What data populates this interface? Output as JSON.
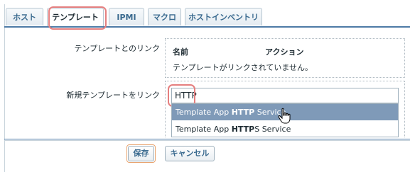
{
  "tabs": [
    {
      "label": "ホスト"
    },
    {
      "label": "テンプレート"
    },
    {
      "label": "IPMI"
    },
    {
      "label": "マクロ"
    },
    {
      "label": "ホストインベントリ"
    }
  ],
  "active_tab": "テンプレート",
  "linked": {
    "label": "テンプレートとのリンク",
    "col_name": "名前",
    "col_action": "アクション",
    "empty_message": "テンプレートがリンクされていません。"
  },
  "new_link": {
    "label": "新規テンプレートをリンク",
    "input_value": "HTTP",
    "suggestions": [
      {
        "prefix": "Template App ",
        "match": "HTTP",
        "suffix": " Service"
      },
      {
        "prefix": "Template App ",
        "match": "HTTP",
        "suffix": "S Service"
      }
    ]
  },
  "buttons": {
    "save": "保存",
    "cancel": "キャンセル"
  },
  "colors": {
    "accent": "#4d7aa6",
    "highlight": "#e57f7f",
    "selected_option": "#7f9ab8"
  }
}
